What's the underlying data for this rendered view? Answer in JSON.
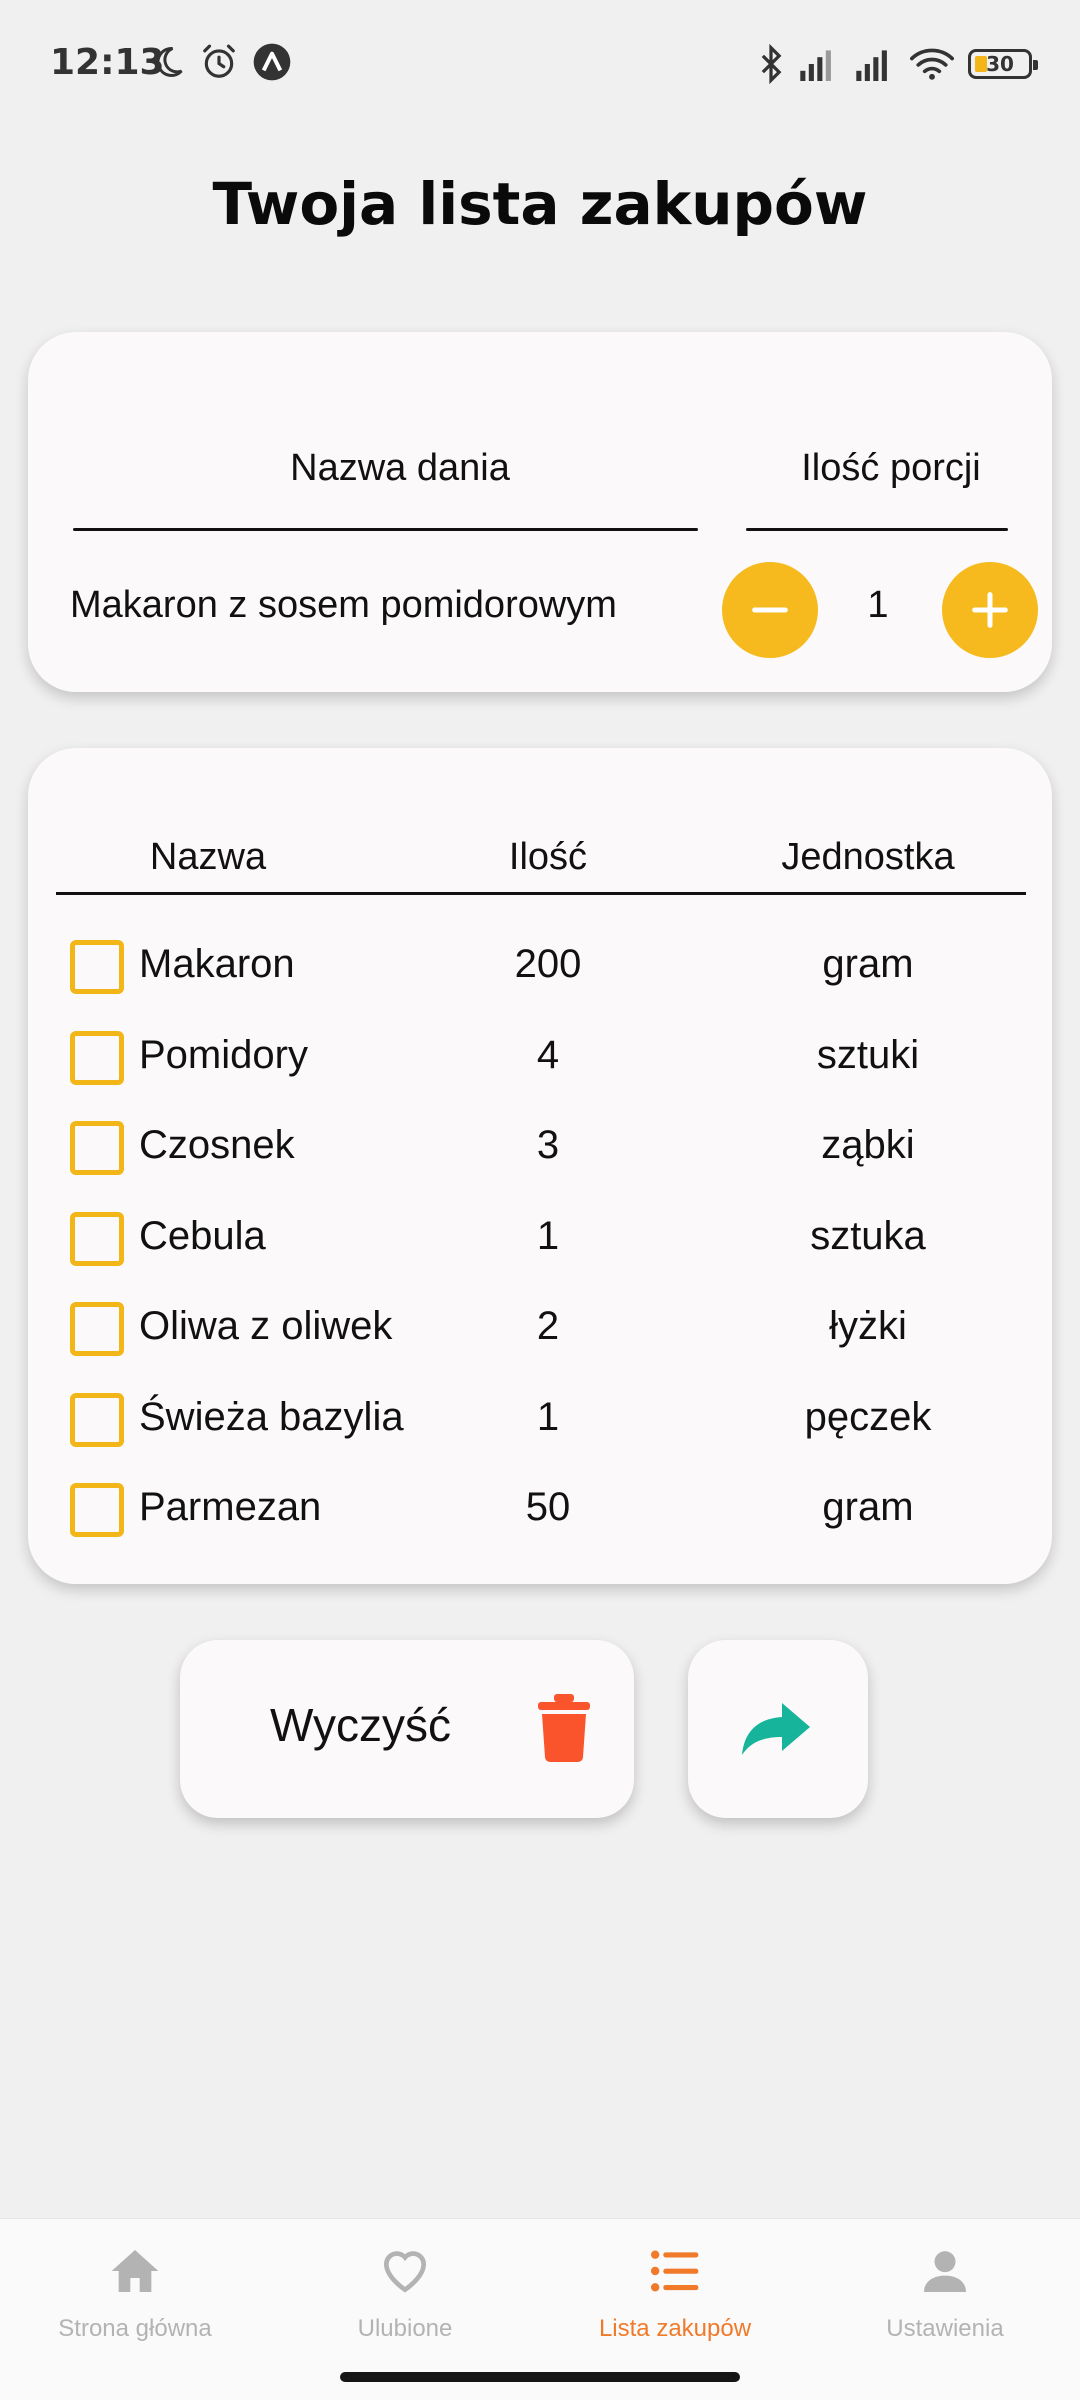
{
  "status_bar": {
    "time": "12:13",
    "left_icons": [
      "moon-icon",
      "alarm-icon",
      "app-notification-icon"
    ],
    "right_icons": [
      "bluetooth-icon",
      "signal-icon",
      "signal-icon",
      "wifi-icon"
    ],
    "battery": "30"
  },
  "page": {
    "title": "Twoja lista zakupów"
  },
  "dish": {
    "column_name": "Nazwa dania",
    "column_portions": "Ilość porcji",
    "name": "Makaron z sosem pomidorowym",
    "portions": "1"
  },
  "shopping_list": {
    "headers": {
      "name": "Nazwa",
      "quantity": "Ilość",
      "unit": "Jednostka"
    },
    "items": [
      {
        "name": "Makaron",
        "quantity": "200",
        "unit": "gram",
        "checked": false
      },
      {
        "name": "Pomidory",
        "quantity": "4",
        "unit": "sztuki",
        "checked": false
      },
      {
        "name": "Czosnek",
        "quantity": "3",
        "unit": "ząbki",
        "checked": false
      },
      {
        "name": "Cebula",
        "quantity": "1",
        "unit": "sztuka",
        "checked": false
      },
      {
        "name": "Oliwa z oliwek",
        "quantity": "2",
        "unit": "łyżki",
        "checked": false
      },
      {
        "name": "Świeża bazylia",
        "quantity": "1",
        "unit": "pęczek",
        "checked": false
      },
      {
        "name": "Parmezan",
        "quantity": "50",
        "unit": "gram",
        "checked": false
      }
    ]
  },
  "actions": {
    "clear_label": "Wyczyść",
    "clear_icon": "trash-icon",
    "share_icon": "share-icon"
  },
  "bottom_nav": {
    "items": [
      {
        "label": "Strona główna",
        "icon": "home-icon",
        "active": false
      },
      {
        "label": "Ulubione",
        "icon": "heart-icon",
        "active": false
      },
      {
        "label": "Lista zakupów",
        "icon": "list-icon",
        "active": true
      },
      {
        "label": "Ustawienia",
        "icon": "user-icon",
        "active": false
      }
    ]
  },
  "colors": {
    "accent_yellow": "#f6ba1f",
    "active_nav": "#f07a2a",
    "trash": "#fa542c",
    "share": "#16b49b"
  }
}
